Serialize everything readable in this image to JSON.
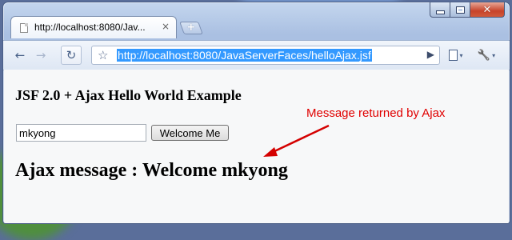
{
  "browser": {
    "tab": {
      "title": "http://localhost:8080/Jav...",
      "close_glyph": "×",
      "favicon": "page-icon"
    },
    "new_tab_glyph": "+",
    "window_controls": {
      "minimize": "minimize-icon",
      "maximize": "maximize-icon",
      "close": "close-icon"
    },
    "toolbar": {
      "back_glyph": "←",
      "forward_glyph": "→",
      "reload_glyph": "↻",
      "star_glyph": "☆",
      "url": "http://localhost:8080/JavaServerFaces/helloAjax.jsf",
      "go_glyph": "▶",
      "page_menu_arrow": "▾",
      "wrench_glyph": "🔧",
      "wrench_arrow": "▾"
    }
  },
  "page": {
    "heading": "JSF 2.0 + Ajax Hello World Example",
    "name_input_value": "mkyong",
    "button_label": "Welcome Me",
    "ajax_message": "Ajax message : Welcome mkyong"
  },
  "annotation": {
    "text": "Message returned by Ajax",
    "color": "#e00000"
  },
  "colors": {
    "url_selection": "#3399ff",
    "window_close": "#c7432a"
  }
}
